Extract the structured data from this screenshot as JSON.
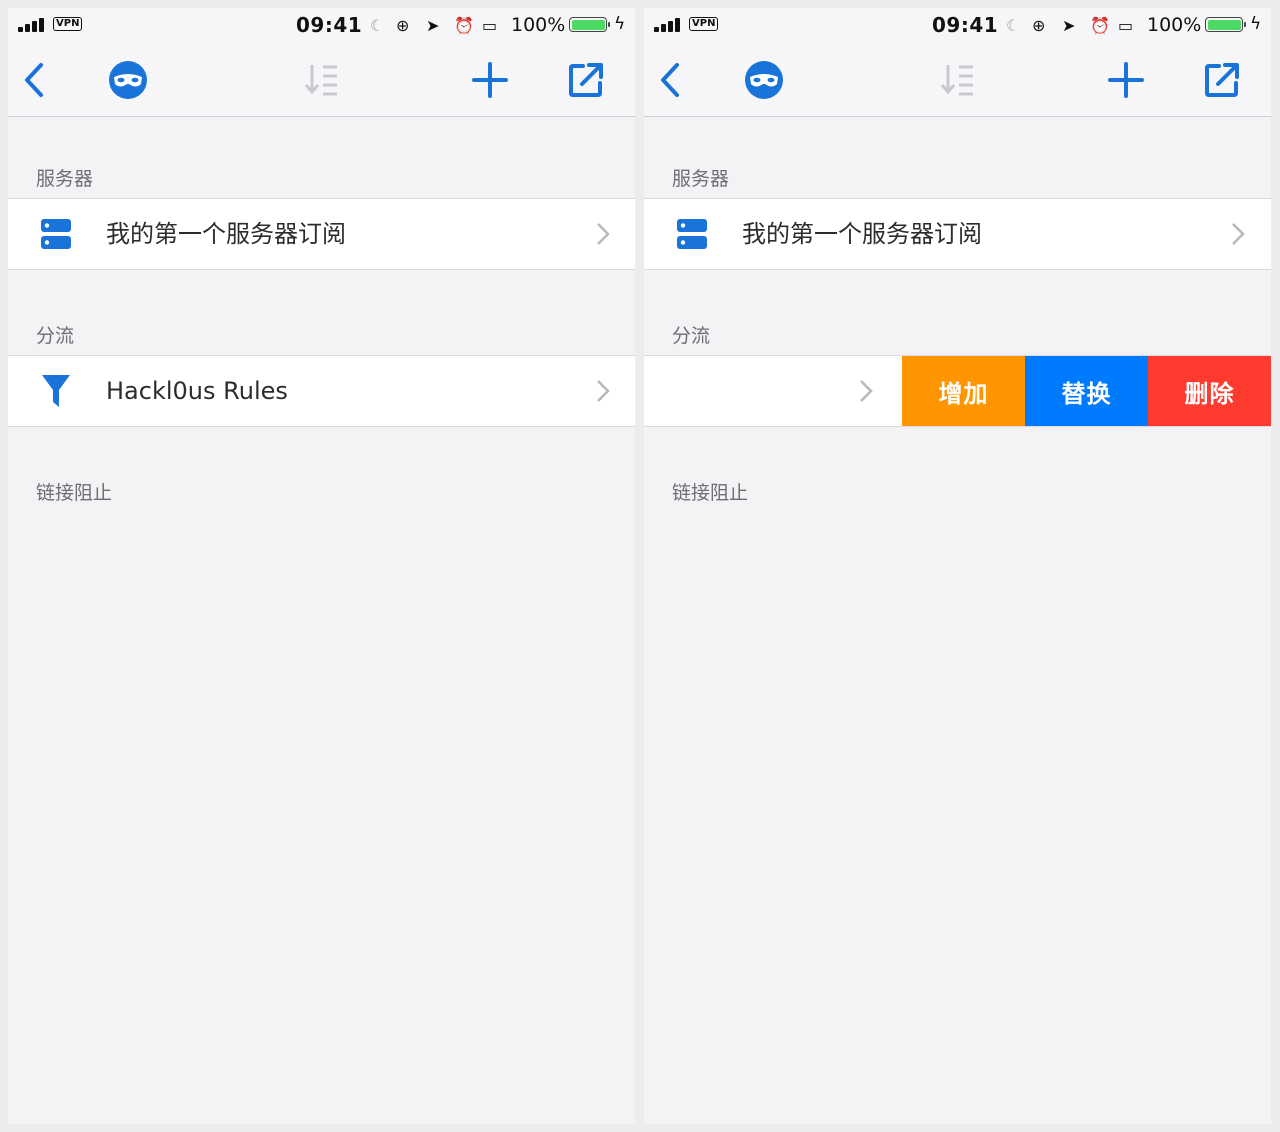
{
  "colors": {
    "accent": "#1a73d9",
    "add": "#ff9500",
    "replace": "#007aff",
    "delete": "#ff3b30",
    "battery": "#4cd964"
  },
  "statusbar": {
    "vpn": "VPN",
    "time": "09:41",
    "battery": "100%",
    "icons": [
      "moon-icon",
      "orientation-lock-icon",
      "location-icon",
      "alarm-icon",
      "airplay-icon",
      "charging-icon"
    ]
  },
  "navbar": {
    "icons": [
      "back-chevron-icon",
      "mask-icon",
      "sort-icon",
      "plus-icon",
      "share-icon"
    ]
  },
  "sections": {
    "server": {
      "title": "服务器",
      "item": "我的第一个服务器订阅"
    },
    "routing": {
      "title": "分流",
      "item": "Hackl0us Rules"
    },
    "block": {
      "title": "链接阻止"
    }
  },
  "swipe_actions": {
    "add": "增加",
    "replace": "替换",
    "delete": "删除"
  }
}
